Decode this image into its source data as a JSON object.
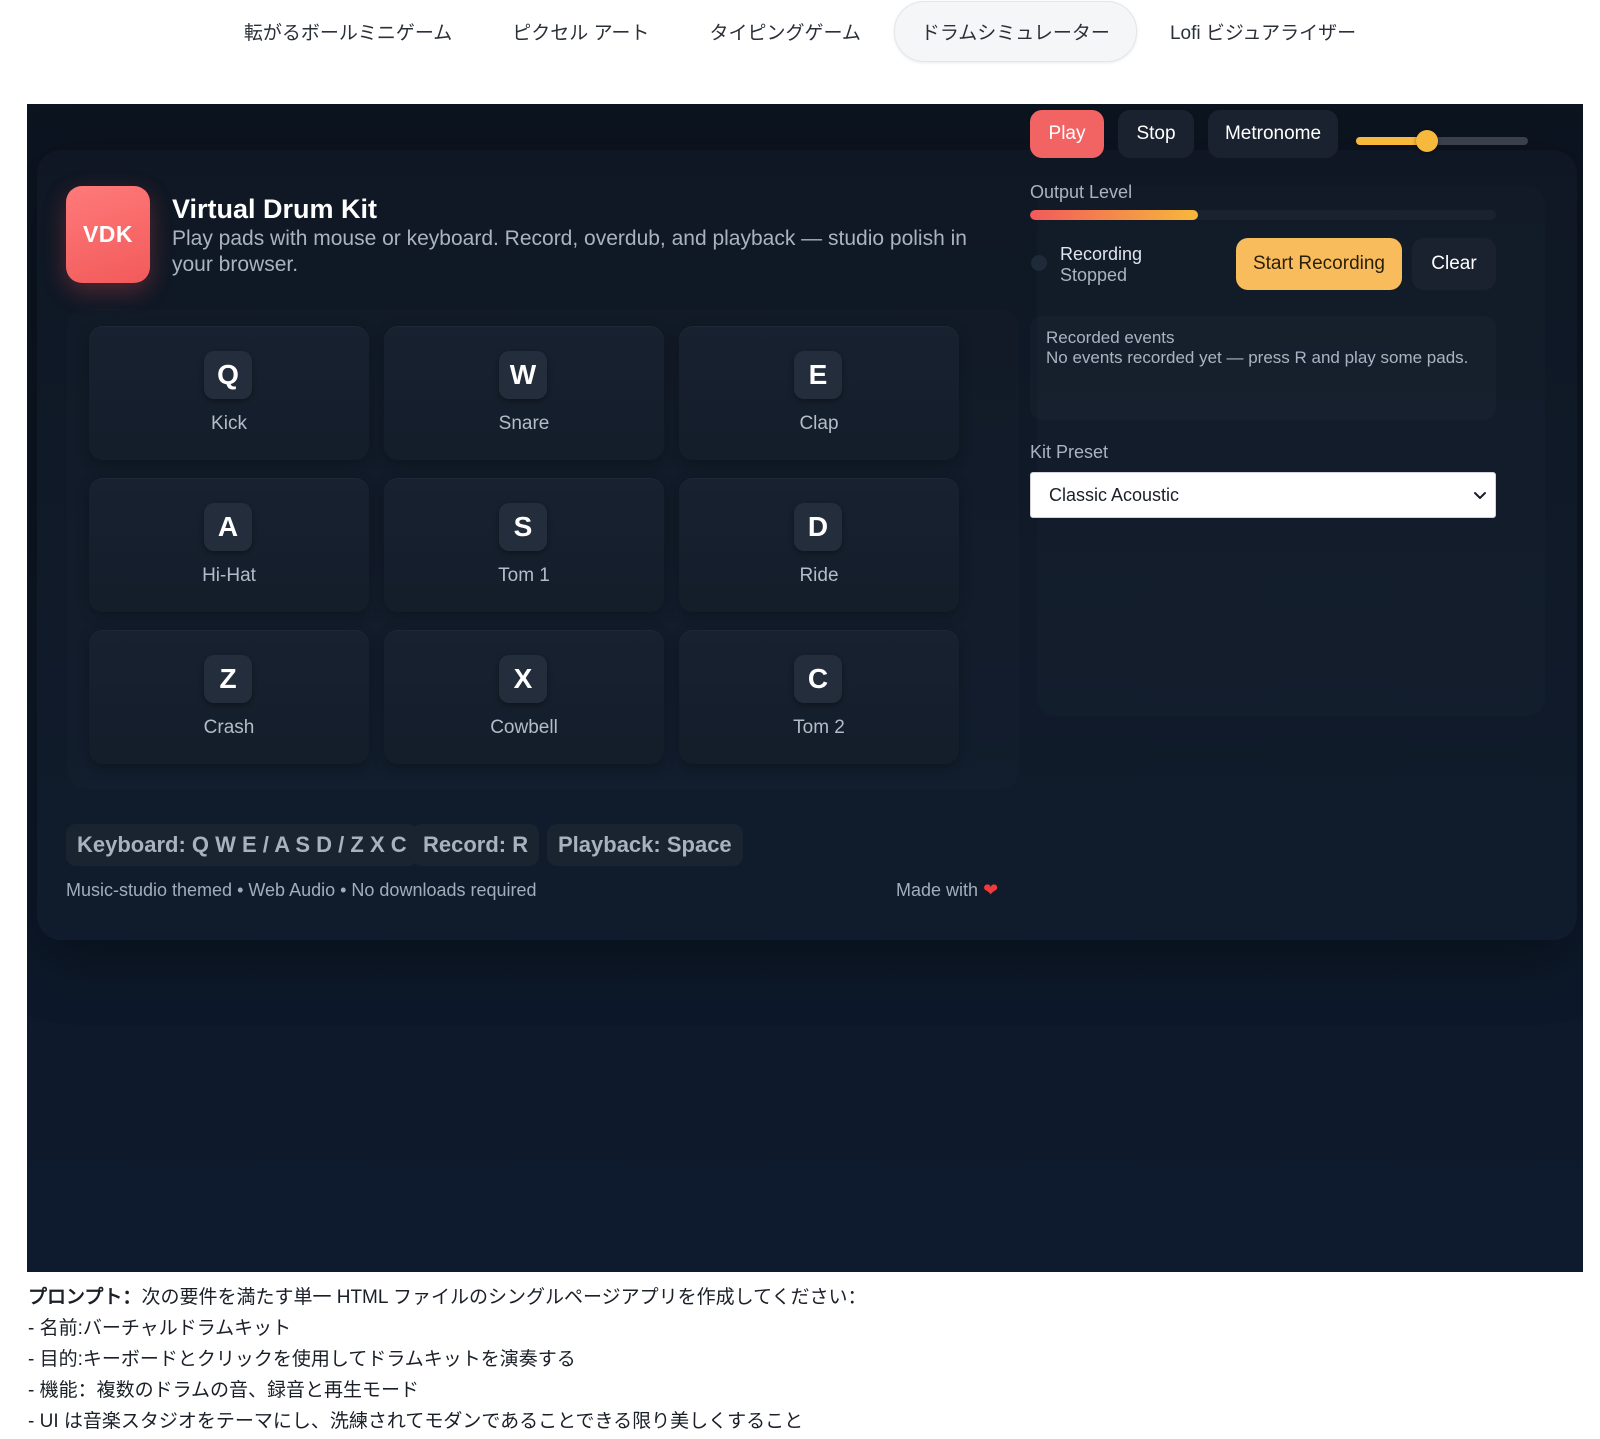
{
  "tabs": [
    {
      "label": "転がるボールミニゲーム",
      "active": false
    },
    {
      "label": "ピクセル アート",
      "active": false
    },
    {
      "label": "タイピングゲーム",
      "active": false
    },
    {
      "label": "ドラムシミュレーター",
      "active": true
    },
    {
      "label": "Lofi ビジュアライザー",
      "active": false
    }
  ],
  "app": {
    "logo": "VDK",
    "title": "Virtual Drum Kit",
    "subtitle": "Play pads with mouse or keyboard. Record, overdub, and playback — studio polish in your browser."
  },
  "pads": [
    {
      "key": "Q",
      "name": "Kick"
    },
    {
      "key": "W",
      "name": "Snare"
    },
    {
      "key": "E",
      "name": "Clap"
    },
    {
      "key": "A",
      "name": "Hi-Hat"
    },
    {
      "key": "S",
      "name": "Tom 1"
    },
    {
      "key": "D",
      "name": "Ride"
    },
    {
      "key": "Z",
      "name": "Crash"
    },
    {
      "key": "X",
      "name": "Cowbell"
    },
    {
      "key": "C",
      "name": "Tom 2"
    }
  ],
  "chips": {
    "keyboard": "Keyboard: Q W E / A S D / Z X C",
    "record": "Record: R",
    "playback": "Playback: Space"
  },
  "footer": {
    "left": "Music-studio themed • Web Audio • No downloads required",
    "right": "Made with"
  },
  "transport": {
    "play": "Play",
    "stop": "Stop",
    "metronome": "Metronome",
    "volume_fraction": 0.41
  },
  "output": {
    "label": "Output Level",
    "level_fraction": 0.36
  },
  "recording": {
    "status_title": "Recording",
    "status_value": "Stopped",
    "start": "Start Recording",
    "clear": "Clear"
  },
  "events": {
    "title": "Recorded events",
    "empty": "No events recorded yet — press R and play some pads."
  },
  "kit": {
    "label": "Kit Preset",
    "selected": "Classic Acoustic"
  },
  "prompt": {
    "heading": "プロンプト：",
    "intro": "次の要件を満たす単一 HTML ファイルのシングルページアプリを作成してください：",
    "lines": [
      "- 名前:バーチャルドラムキット",
      "- 目的:キーボードとクリックを使用してドラムキットを演奏する",
      "- 機能：複数のドラムの音、録音と再生モード",
      "- UI は音楽スタジオをテーマにし、洗練されてモダンであることできる限り美しくすること"
    ]
  },
  "colors": {
    "accent_red": "#f26464",
    "accent_amber": "#f8bc5c",
    "stage_bg": "#0d1828"
  }
}
